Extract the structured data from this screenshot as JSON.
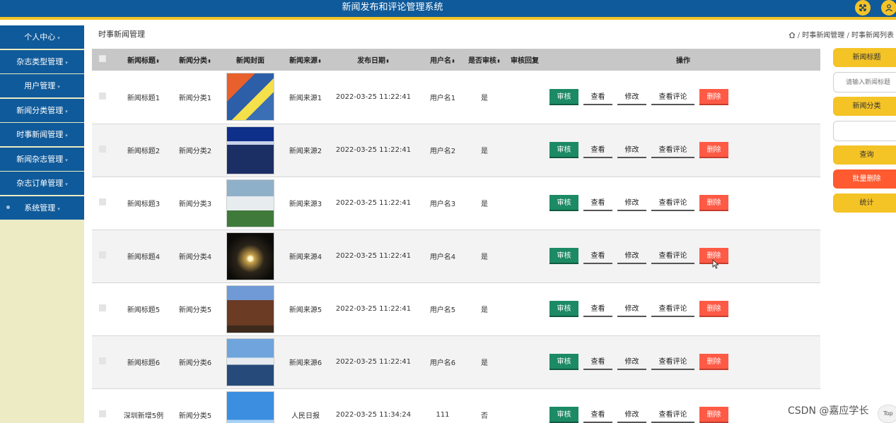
{
  "header": {
    "title": "新闻发布和评论管理系统",
    "fullscreen_icon": "expand-icon",
    "user_icon": "user-icon",
    "brand_color": "#0f5a9a",
    "accent_color": "#f4c326"
  },
  "sidebar": {
    "items": [
      {
        "label": "个人中心"
      },
      {
        "label": "杂志类型管理"
      },
      {
        "label": "用户管理"
      },
      {
        "label": "新闻分类管理"
      },
      {
        "label": "时事新闻管理"
      },
      {
        "label": "新闻杂志管理"
      },
      {
        "label": "杂志订单管理"
      },
      {
        "label": "系统管理"
      }
    ]
  },
  "page": {
    "heading": "时事新闻管理",
    "breadcrumb": [
      "时事新闻管理",
      "时事新闻列表"
    ]
  },
  "table": {
    "columns": [
      "新闻标题",
      "新闻分类",
      "新闻封面",
      "新闻来源",
      "发布日期",
      "用户名",
      "是否审核",
      "审核回复",
      "操作"
    ],
    "actions": {
      "review": "审核",
      "view": "查看",
      "edit": "修改",
      "comments": "查看评论",
      "delete": "删除"
    },
    "rows": [
      {
        "title": "新闻标题1",
        "category": "新闻分类1",
        "source": "新闻来源1",
        "date": "2022-03-25 11:22:41",
        "user": "用户名1",
        "audited": "是",
        "reply": "",
        "cover": "magazine-cover-image"
      },
      {
        "title": "新闻标题2",
        "category": "新闻分类2",
        "source": "新闻来源2",
        "date": "2022-03-25 11:22:41",
        "user": "用户名2",
        "audited": "是",
        "reply": "",
        "cover": "press-conference-image"
      },
      {
        "title": "新闻标题3",
        "category": "新闻分类3",
        "source": "新闻来源3",
        "date": "2022-03-25 11:22:41",
        "user": "用户名3",
        "audited": "是",
        "reply": "",
        "cover": "group-outdoor-image"
      },
      {
        "title": "新闻标题4",
        "category": "新闻分类4",
        "source": "新闻来源4",
        "date": "2022-03-25 11:22:41",
        "user": "用户名4",
        "audited": "是",
        "reply": "",
        "cover": "dark-light-image"
      },
      {
        "title": "新闻标题5",
        "category": "新闻分类5",
        "source": "新闻来源5",
        "date": "2022-03-25 11:22:41",
        "user": "用户名5",
        "audited": "是",
        "reply": "",
        "cover": "pagoda-image"
      },
      {
        "title": "新闻标题6",
        "category": "新闻分类6",
        "source": "新闻来源6",
        "date": "2022-03-25 11:22:41",
        "user": "用户名6",
        "audited": "是",
        "reply": "",
        "cover": "cruise-ship-image"
      },
      {
        "title": "深圳新增5例",
        "category": "新闻分类5",
        "source": "人民日报",
        "date": "2022-03-25 11:34:24",
        "user": "111",
        "audited": "否",
        "reply": "",
        "cover": "blue-sky-image"
      }
    ]
  },
  "right_panel": {
    "title_label": "新闻标题",
    "title_placeholder": "请输入新闻标题",
    "category_label": "新闻分类",
    "category_value": "",
    "search": "查询",
    "batch_delete": "批量删除",
    "stats": "统计"
  },
  "watermark": "CSDN @嘉应学长",
  "top_button": "Top"
}
